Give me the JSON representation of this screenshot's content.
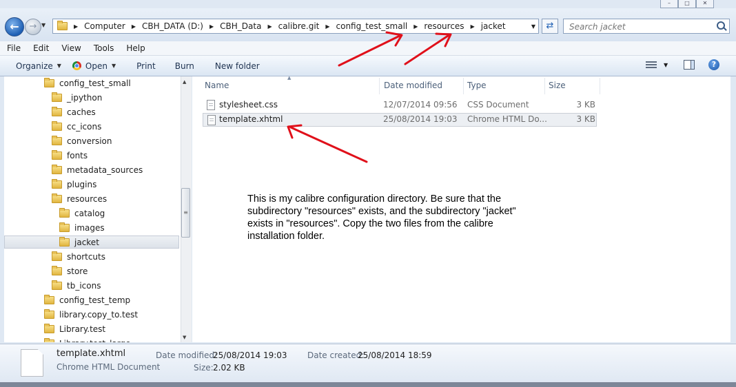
{
  "address": {
    "crumbs": [
      "Computer",
      "CBH_DATA (D:)",
      "CBH_Data",
      "calibre.git",
      "config_test_small",
      "resources",
      "jacket"
    ]
  },
  "search": {
    "placeholder": "Search jacket"
  },
  "menu": [
    "File",
    "Edit",
    "View",
    "Tools",
    "Help"
  ],
  "toolbar": {
    "organize": "Organize",
    "open": "Open",
    "print": "Print",
    "burn": "Burn",
    "new_folder": "New folder"
  },
  "nav_tree": [
    {
      "label": "config_test_small",
      "level": 0
    },
    {
      "label": "_ipython",
      "level": 1
    },
    {
      "label": "caches",
      "level": 1
    },
    {
      "label": "cc_icons",
      "level": 1
    },
    {
      "label": "conversion",
      "level": 1
    },
    {
      "label": "fonts",
      "level": 1
    },
    {
      "label": "metadata_sources",
      "level": 1
    },
    {
      "label": "plugins",
      "level": 1
    },
    {
      "label": "resources",
      "level": 1
    },
    {
      "label": "catalog",
      "level": 2
    },
    {
      "label": "images",
      "level": 2
    },
    {
      "label": "jacket",
      "level": 2,
      "selected": true
    },
    {
      "label": "shortcuts",
      "level": 1
    },
    {
      "label": "store",
      "level": 1
    },
    {
      "label": "tb_icons",
      "level": 1
    },
    {
      "label": "config_test_temp",
      "level": 0
    },
    {
      "label": "library.copy_to.test",
      "level": 0
    },
    {
      "label": "Library.test",
      "level": 0
    },
    {
      "label": "Library.test_large",
      "level": 0
    }
  ],
  "columns": {
    "name": "Name",
    "date_modified": "Date modified",
    "type": "Type",
    "size": "Size"
  },
  "files": [
    {
      "name": "stylesheet.css",
      "date_modified": "12/07/2014 09:56",
      "type": "CSS Document",
      "size": "3 KB"
    },
    {
      "name": "template.xhtml",
      "date_modified": "25/08/2014 19:03",
      "type": "Chrome HTML Do...",
      "size": "3 KB",
      "selected": true
    }
  ],
  "details": {
    "file_name": "template.xhtml",
    "file_type": "Chrome HTML Document",
    "date_modified_label": "Date modified:",
    "date_modified": "25/08/2014 19:03",
    "date_created_label": "Date created:",
    "date_created": "25/08/2014 18:59",
    "size_label": "Size:",
    "size": "2.02 KB"
  },
  "annotation": {
    "text": "This is my calibre configuration directory. Be sure that the subdirectory \"resources\" exists, and the subdirectory \"jacket\" exists in \"resources\". Copy the two files from the calibre installation folder.",
    "arrow_color": "#e0101a"
  }
}
